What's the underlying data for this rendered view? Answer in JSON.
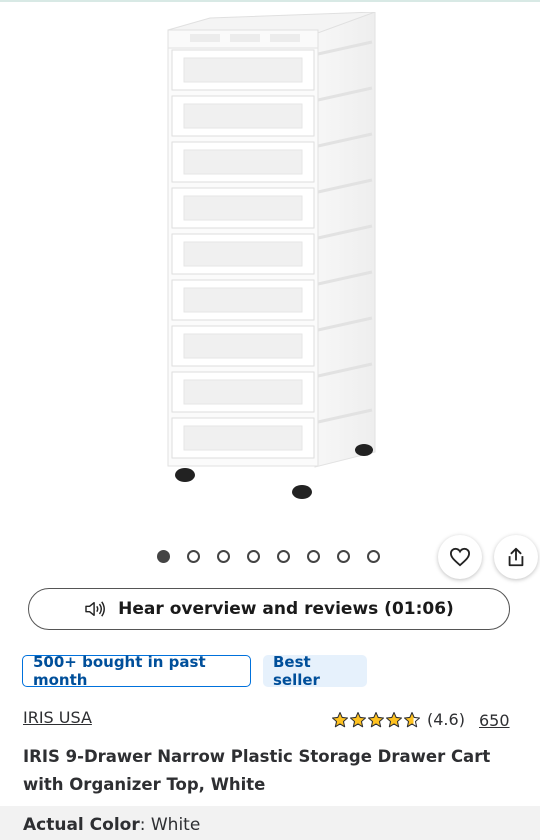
{
  "gallery": {
    "image_alt": "IRIS 9-Drawer Narrow Plastic Storage Drawer Cart",
    "dot_count": 8,
    "active_index": 0
  },
  "icons": {
    "favorite": "heart-icon",
    "share": "share-icon",
    "audio": "speaker-icon",
    "star": "star-icon"
  },
  "audio": {
    "label": "Hear overview and reviews (01:06)"
  },
  "badges": {
    "bought": "500+ bought in past month",
    "best": "Best seller"
  },
  "brand": "IRIS USA",
  "rating": {
    "value": "(4.6)",
    "stars": 4.6,
    "count": "650"
  },
  "product": {
    "title": "IRIS 9-Drawer Narrow Plastic Storage Drawer Cart with Organizer Top, White"
  },
  "color": {
    "label": "Actual Color",
    "value": "White"
  },
  "colors": {
    "accent": "#0071dc",
    "badge_text": "#004f9a",
    "badge_bg": "#e6f1fc",
    "star": "#ffc220"
  }
}
